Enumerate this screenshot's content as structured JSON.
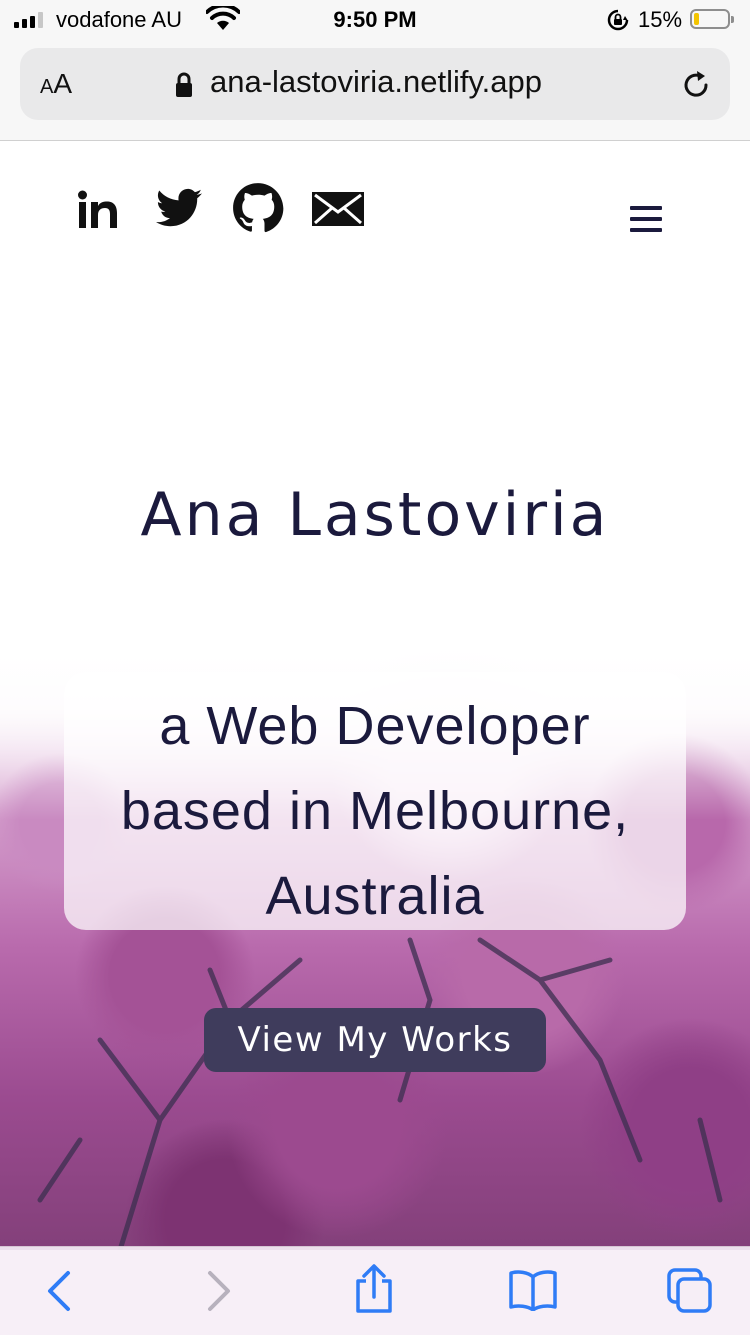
{
  "status_bar": {
    "carrier": "vodafone AU",
    "time": "9:50 PM",
    "battery_percent": "15%",
    "battery_level": 0.15
  },
  "browser": {
    "text_size_label_small": "A",
    "text_size_label_large": "A",
    "url": "ana-lastoviria.netlify.app"
  },
  "header": {
    "social_icons": [
      "linkedin-icon",
      "twitter-icon",
      "github-icon",
      "email-icon"
    ],
    "menu_icon": "hamburger-menu-icon"
  },
  "hero": {
    "name": "Ana Lastoviria",
    "tagline_lines": [
      "a Web Developer",
      "based in Melbourne,",
      "Australia"
    ],
    "cta_label": "View My Works"
  },
  "colors": {
    "text": "#1b1a3d",
    "button": "#3f3c5c",
    "ios_blue": "#2f7cf6"
  },
  "toolbar": {
    "icons": [
      "back-icon",
      "forward-icon",
      "share-icon",
      "bookmarks-icon",
      "tabs-icon"
    ]
  }
}
